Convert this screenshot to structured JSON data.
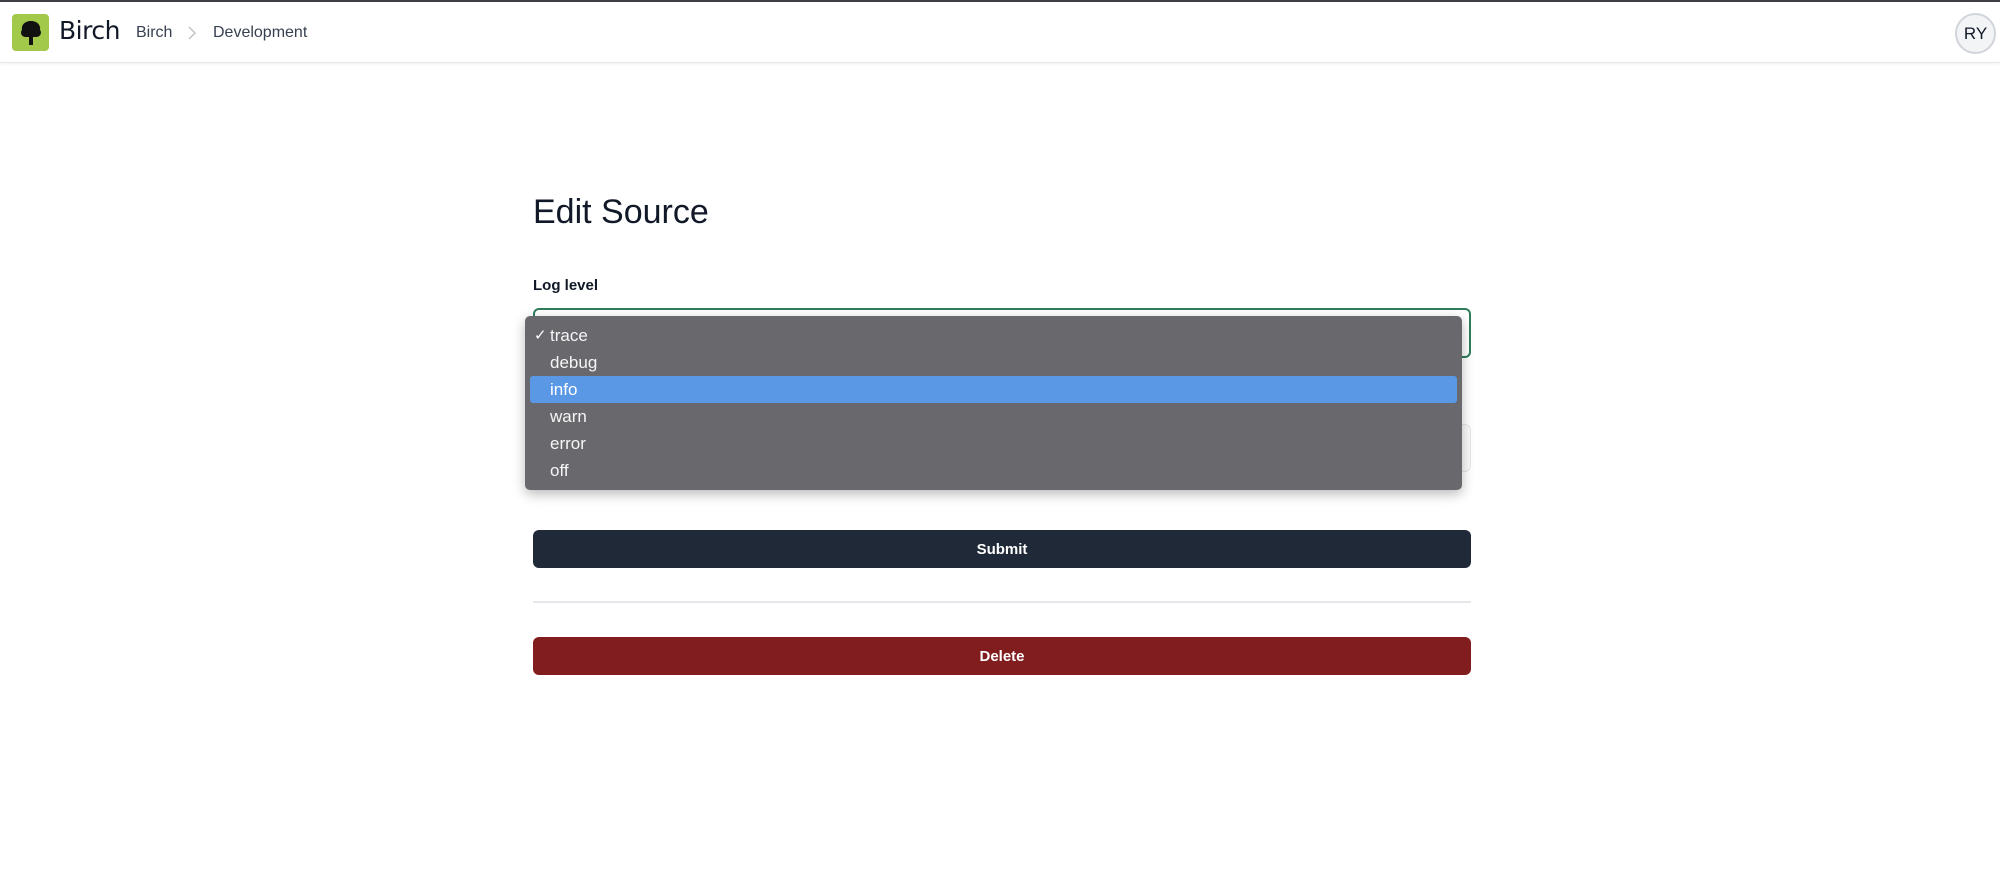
{
  "header": {
    "brand": "Birch",
    "breadcrumb": [
      "Birch",
      "Development"
    ],
    "avatar_initials": "RY",
    "logo_icon": "tree-icon",
    "logo_color": "#a3c94a"
  },
  "main": {
    "title": "Edit Source",
    "log_level": {
      "label": "Log level",
      "selected": "trace",
      "highlighted": "info",
      "options": [
        "trace",
        "debug",
        "info",
        "warn",
        "error",
        "off"
      ]
    },
    "submit_label": "Submit",
    "delete_label": "Delete"
  },
  "colors": {
    "submit": "#1f2937",
    "delete": "#811d1f",
    "highlight": "#5a98e6",
    "focus_border": "#2f7d5b"
  }
}
